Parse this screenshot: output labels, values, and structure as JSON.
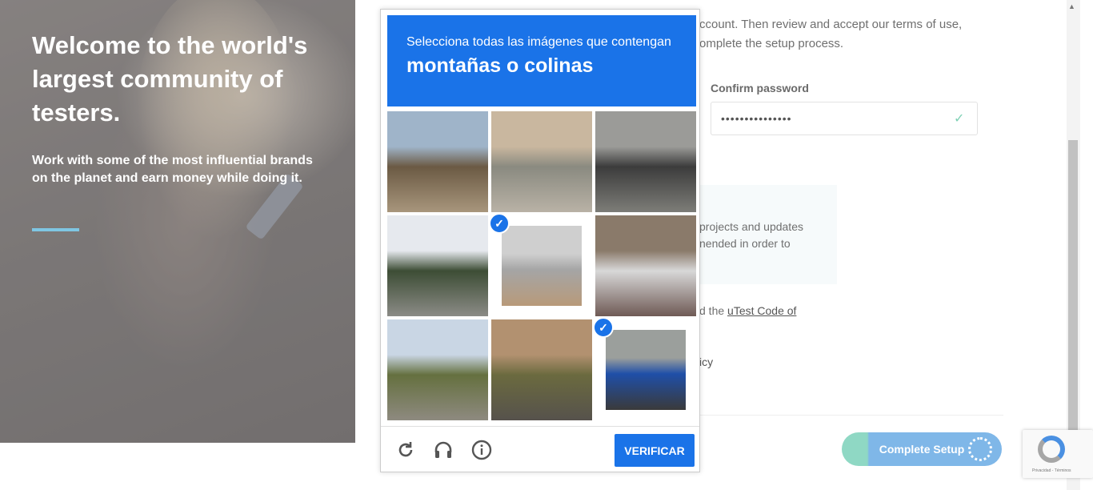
{
  "hero": {
    "title": "Welcome to the world's largest community of testers.",
    "subtitle": "Work with some of the most influential brands on the planet and earn money while doing it."
  },
  "form": {
    "intro_line_1": "ccount. Then review and accept our terms of use,",
    "intro_line_2": "omplete the setup process.",
    "confirm_password_label": "Confirm password",
    "confirm_password_value": "•••••••••••••••",
    "info_line_1": "projects and updates",
    "info_line_2": "nended in order to",
    "code_prefix": "d the ",
    "code_link": "uTest Code of",
    "policy_fragment": "icy",
    "complete_setup_label": "Complete Setup"
  },
  "recaptcha_badge": {
    "text": "Privacidad - Términos"
  },
  "captcha": {
    "instruction": "Selecciona todas las imágenes que contengan",
    "target": "montañas o colinas",
    "verify_label": "VERIFICAR",
    "icons": [
      "reload-icon",
      "audio-icon",
      "info-icon"
    ],
    "tiles": [
      {
        "name": "tile-desert-hill",
        "selected": false,
        "colors": [
          "#9fb4c9",
          "#6b5a44",
          "#a8967c"
        ]
      },
      {
        "name": "tile-street-building",
        "selected": false,
        "colors": [
          "#c9b79f",
          "#8a8a80",
          "#b9b2a6"
        ]
      },
      {
        "name": "tile-motorcycle",
        "selected": false,
        "colors": [
          "#9b9b98",
          "#3c3c3c",
          "#7d7d78"
        ]
      },
      {
        "name": "tile-palm-trees",
        "selected": false,
        "colors": [
          "#e6e9ee",
          "#3d4d35",
          "#8b8b86"
        ]
      },
      {
        "name": "tile-mailbox",
        "selected": true,
        "colors": [
          "#cfcfcf",
          "#a5a5a5",
          "#b89a7a"
        ]
      },
      {
        "name": "tile-stairs-bush",
        "selected": false,
        "colors": [
          "#8a7a6a",
          "#d8d8d8",
          "#6f5a55"
        ]
      },
      {
        "name": "tile-road-valley",
        "selected": false,
        "colors": [
          "#c9d6e4",
          "#65703f",
          "#8e8a80"
        ]
      },
      {
        "name": "tile-road-hillside",
        "selected": false,
        "colors": [
          "#b29170",
          "#6b6a3f",
          "#56524c"
        ]
      },
      {
        "name": "tile-scooter-sign",
        "selected": true,
        "colors": [
          "#9b9f9c",
          "#1f4fa8",
          "#3a3a3a"
        ]
      }
    ]
  }
}
